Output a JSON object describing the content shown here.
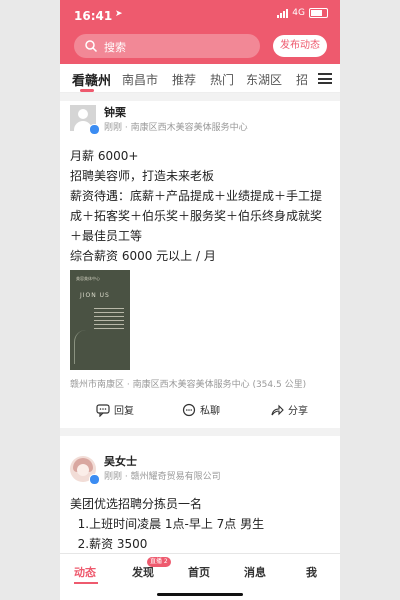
{
  "status_bar": {
    "time": "16:41",
    "network": "4G"
  },
  "header": {
    "search_placeholder": "搜索",
    "publish_label": "发布动态"
  },
  "tabs": [
    "看赣州",
    "南昌市",
    "推荐",
    "热门",
    "东湖区",
    "招"
  ],
  "active_tab": 0,
  "posts": [
    {
      "author": "钟栗",
      "meta": "刚刚 · 南康区西木美容美体服务中心",
      "lines": [
        "月薪 6000+",
        "招聘美容师，打造未来老板",
        "薪资待遇：底薪＋产品提成＋业绩提成＋手工提",
        "成＋拓客奖＋伯乐奖＋服务奖＋伯乐终身成就奖",
        "＋最佳员工等",
        "综合薪资 6000 元以上 / 月"
      ],
      "card_text": {
        "brand": "美容美体中心",
        "join": "JION US"
      },
      "location": "赣州市南康区 · 南康区西木美容美体服务中心 (354.5 公里)",
      "actions": {
        "reply": "回复",
        "message": "私聊",
        "share": "分享"
      }
    },
    {
      "author": "吴女士",
      "meta": "刚刚 · 赣州耀奇贸易有限公司",
      "lines": [
        "美团优选招聘分拣员一名",
        "  1.上班时间凌晨 1点-早上 7点 男生",
        "  2.薪资 3500"
      ]
    }
  ],
  "bottom_nav": [
    {
      "label": "动态"
    },
    {
      "label": "发现",
      "badge": "直播 2"
    },
    {
      "label": "首页"
    },
    {
      "label": "消息"
    },
    {
      "label": "我"
    }
  ],
  "colors": {
    "brand": "#ee5a6e",
    "verified": "#3b8cf2"
  }
}
